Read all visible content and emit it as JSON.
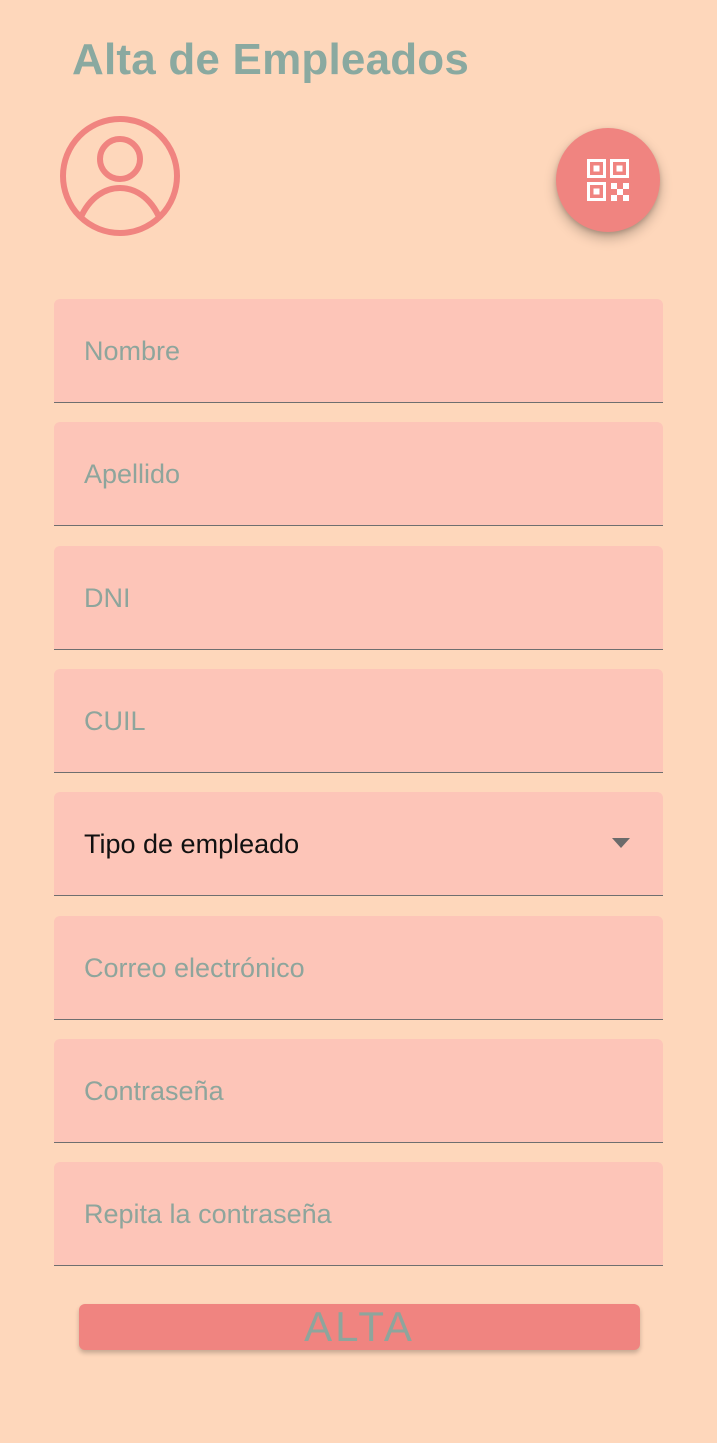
{
  "page": {
    "title": "Alta de Empleados"
  },
  "colors": {
    "background": "#fed7bb",
    "accent": "#f08480",
    "field_bg": "#fdc5b8",
    "text_muted": "#8ea59c",
    "title": "#8aa9a0"
  },
  "icons": {
    "avatar": "person-circle-icon",
    "qr": "qr-code-icon",
    "dropdown": "dropdown-caret-icon"
  },
  "form": {
    "nombre": {
      "placeholder": "Nombre",
      "value": ""
    },
    "apellido": {
      "placeholder": "Apellido",
      "value": ""
    },
    "dni": {
      "placeholder": "DNI",
      "value": ""
    },
    "cuil": {
      "placeholder": "CUIL",
      "value": ""
    },
    "tipo_empleado": {
      "selected": "Tipo de empleado"
    },
    "correo": {
      "placeholder": "Correo electrónico",
      "value": ""
    },
    "contrasena": {
      "placeholder": "Contraseña",
      "value": ""
    },
    "repetir_contrasena": {
      "placeholder": "Repita la contraseña",
      "value": ""
    }
  },
  "actions": {
    "submit_label": "ALTA"
  }
}
